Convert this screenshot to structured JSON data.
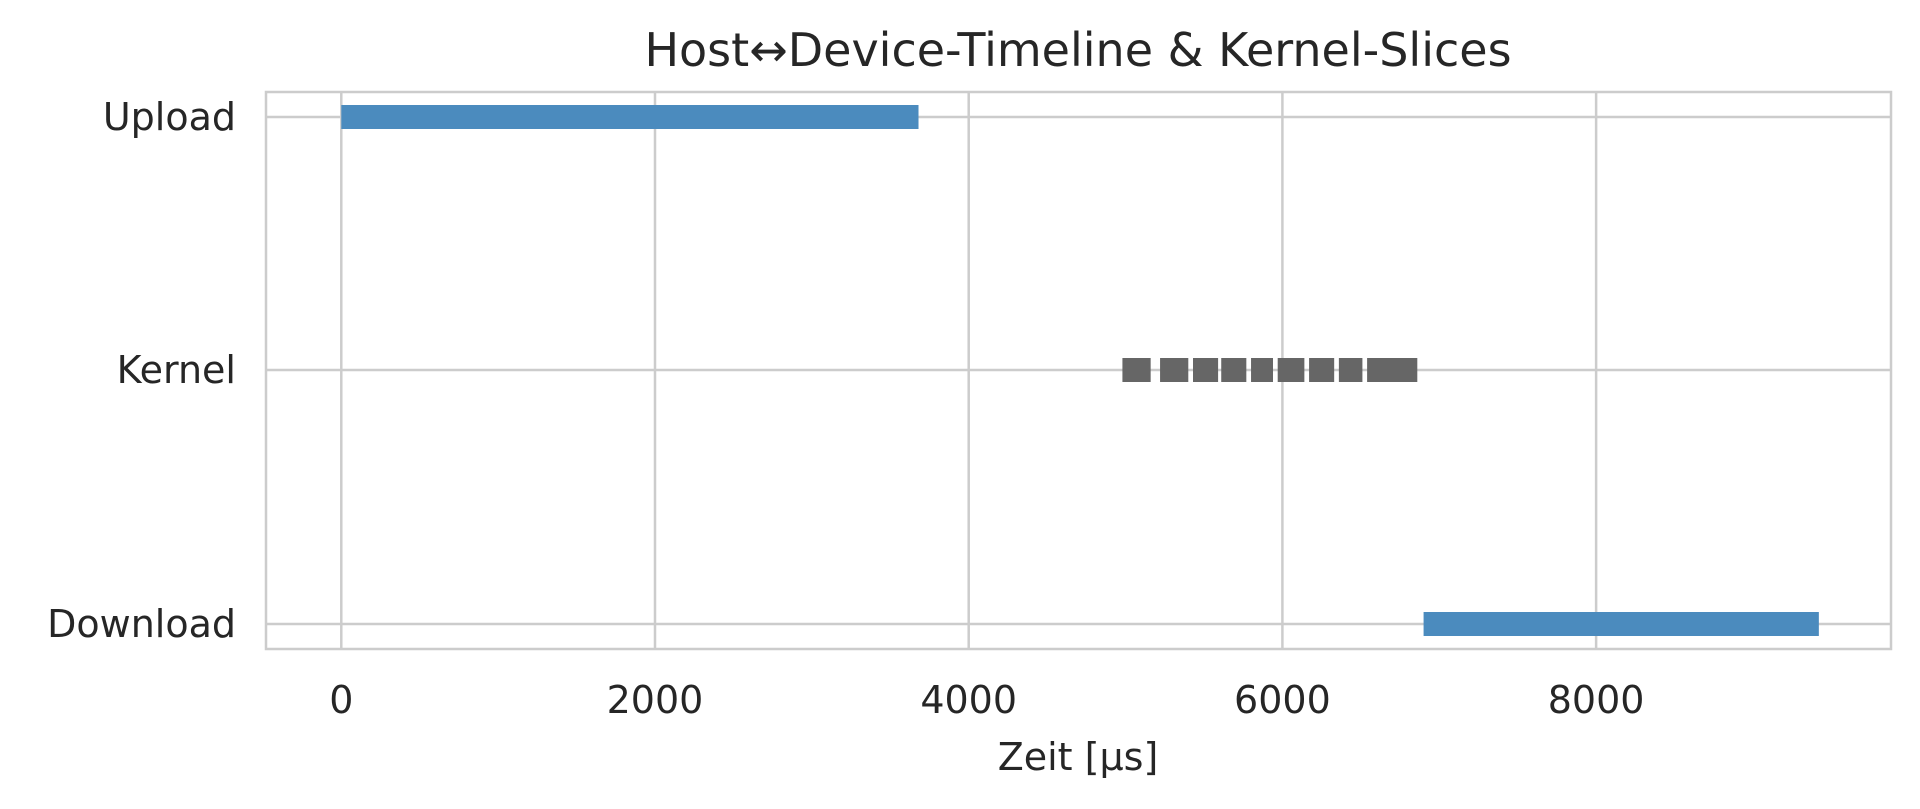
{
  "chart_data": {
    "type": "bar",
    "orientation": "horizontal",
    "chart_kind": "gantt-timeline",
    "title": "Host↔Device-Timeline & Kernel-Slices",
    "xlabel": "Zeit [µs]",
    "ylabel": "",
    "xlim": [
      -480,
      9880
    ],
    "xticks": [
      0,
      2000,
      4000,
      6000,
      8000
    ],
    "xtick_labels": [
      "0",
      "2000",
      "4000",
      "6000",
      "8000"
    ],
    "categories": [
      "Upload",
      "Kernel",
      "Download"
    ],
    "grid": true,
    "legend": "none",
    "colors": {
      "transfer": "#4b8bbe",
      "kernel": "#666666",
      "grid": "#cccccc",
      "spine": "#cccccc",
      "text": "#262626"
    },
    "series": [
      {
        "category": "Upload",
        "segments": [
          {
            "start": 0,
            "end": 3680
          }
        ]
      },
      {
        "category": "Kernel",
        "segments": [
          {
            "start": 4980,
            "end": 5160
          },
          {
            "start": 5220,
            "end": 5400
          },
          {
            "start": 5430,
            "end": 5590
          },
          {
            "start": 5610,
            "end": 5770
          },
          {
            "start": 5800,
            "end": 5940
          },
          {
            "start": 5970,
            "end": 6140
          },
          {
            "start": 6170,
            "end": 6330
          },
          {
            "start": 6360,
            "end": 6510
          },
          {
            "start": 6540,
            "end": 6860
          }
        ]
      },
      {
        "category": "Download",
        "segments": [
          {
            "start": 6900,
            "end": 9420
          }
        ]
      }
    ]
  }
}
